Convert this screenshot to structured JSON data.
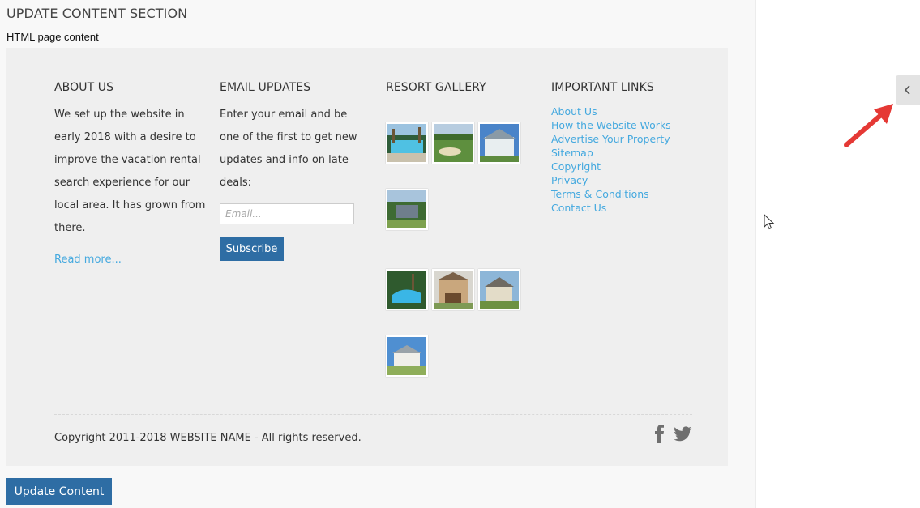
{
  "page": {
    "section_title": "UPDATE CONTENT SECTION",
    "field_label": "HTML page content",
    "update_button": "Update Content"
  },
  "footer": {
    "about": {
      "heading": "ABOUT US",
      "text": "We set up the website in early 2018 with a desire to improve the vacation rental search experience for our local area. It has grown from there.",
      "read_more": "Read more..."
    },
    "email": {
      "heading": "EMAIL UPDATES",
      "text": "Enter your email and be one of the first to get new updates and info on late deals:",
      "placeholder": "Email...",
      "value": "",
      "subscribe": "Subscribe"
    },
    "gallery": {
      "heading": "RESORT GALLERY",
      "images": [
        "pool-photo",
        "golf-course-photo",
        "house-photo",
        "entrance-sign-photo",
        "resort-pool-photo",
        "townhouse-photo",
        "villa-photo",
        "clubhouse-photo"
      ]
    },
    "links": {
      "heading": "IMPORTANT LINKS",
      "items": [
        "About Us",
        "How the Website Works",
        "Advertise Your Property",
        "Sitemap",
        "Copyright",
        "Privacy",
        "Terms & Conditions",
        "Contact Us"
      ]
    },
    "copyright": "Copyright 2011-2018 WEBSITE NAME - All rights reserved.",
    "social": [
      "facebook-icon",
      "twitter-icon"
    ]
  },
  "colors": {
    "primary_button": "#2e6da4",
    "link": "#45a9df",
    "annotation_arrow": "#e53935"
  },
  "sidebar_toggle": {
    "icon": "chevron-left-icon"
  }
}
